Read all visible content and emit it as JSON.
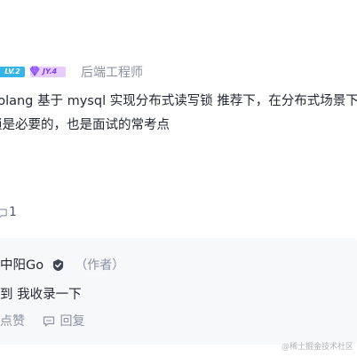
{
  "header": {
    "level_badge": "LV.2",
    "jy_badge": "JY.4",
    "job_title": "后端工程师"
  },
  "content": {
    "line1": "golang 基于 mysql 实现分布式读写锁 推荐下，在分布式场景下，附",
    "line2": "锁是必要的，也是面试的常考点"
  },
  "stats": {
    "comment_count": "1"
  },
  "reply": {
    "username": "中阳Go",
    "author_tag": "（作者）",
    "text": "到 我收录一下",
    "like_label": "点赞",
    "reply_label": "回复"
  },
  "watermark": "@稀土掘金技术社区",
  "colors": {
    "level_badge": "#35b4e6",
    "jy_badge_bg": "#e6ccff",
    "jy_badge_text": "#7a3dff",
    "muted_text": "#8a919f",
    "reply_bg": "#f7f8fa"
  }
}
